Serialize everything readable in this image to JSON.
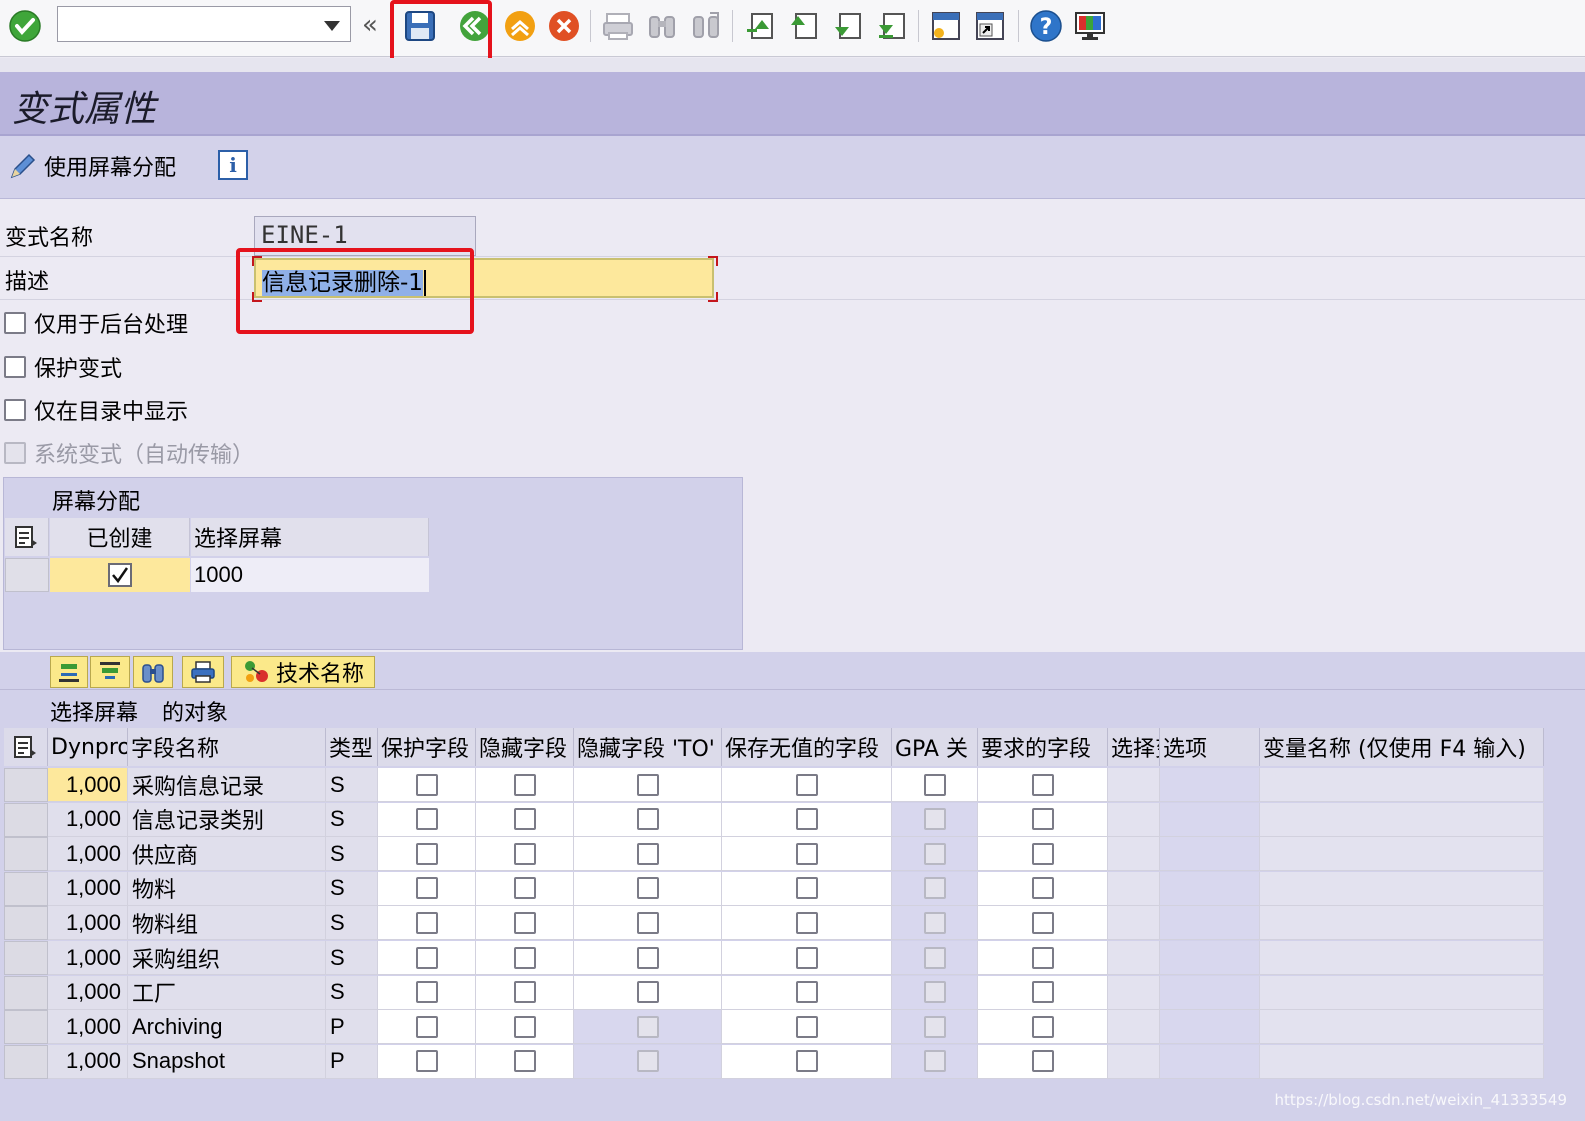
{
  "toolbar": {
    "command_field_value": "",
    "icons": [
      "enter-icon",
      "save-icon",
      "back-icon",
      "exit-icon",
      "cancel-icon",
      "print-icon",
      "find-icon",
      "find-next-icon",
      "first-page-icon",
      "previous-page-icon",
      "next-page-icon",
      "last-page-icon",
      "create-session-icon",
      "shortcut-icon",
      "help-icon",
      "layout-icon"
    ]
  },
  "page": {
    "title": "变式属性"
  },
  "app_toolbar": {
    "screen_assignment_label": "使用屏幕分配",
    "info_glyph": "i"
  },
  "form": {
    "variant_name_label": "变式名称",
    "variant_name_value": "EINE-1",
    "description_label": "描述",
    "description_value": "信息记录删除-1",
    "checkboxes": [
      {
        "label": "仅用于后台处理",
        "checked": false,
        "enabled": true
      },
      {
        "label": "保护变式",
        "checked": false,
        "enabled": true
      },
      {
        "label": "仅在目录中显示",
        "checked": false,
        "enabled": true
      },
      {
        "label": "系统变式（自动传输）",
        "checked": false,
        "enabled": false
      }
    ]
  },
  "screen_assignment": {
    "title": "屏幕分配",
    "col_created": "已创建",
    "col_screen": "选择屏幕",
    "rows": [
      {
        "created": true,
        "screen": "1000"
      }
    ]
  },
  "objects": {
    "tech_name_button": "技术名称",
    "title_part1": "选择屏幕",
    "title_part2": "的对象",
    "headers": [
      "Dynpro",
      "字段名称",
      "类型",
      "保护字段",
      "隐藏字段",
      "隐藏字段 'TO'",
      "保存无值的字段",
      "GPA 关",
      "要求的字段",
      "选择变量",
      "选项",
      "变量名称 (仅使用 F4 输入)"
    ],
    "rows": [
      {
        "dynpro": "1,000",
        "field": "采购信息记录",
        "type": "S"
      },
      {
        "dynpro": "1,000",
        "field": "信息记录类别",
        "type": "S"
      },
      {
        "dynpro": "1,000",
        "field": "供应商",
        "type": "S"
      },
      {
        "dynpro": "1,000",
        "field": "物料",
        "type": "S"
      },
      {
        "dynpro": "1,000",
        "field": "物料组",
        "type": "S"
      },
      {
        "dynpro": "1,000",
        "field": "采购组织",
        "type": "S"
      },
      {
        "dynpro": "1,000",
        "field": "工厂",
        "type": "S"
      },
      {
        "dynpro": "1,000",
        "field": "Archiving",
        "type": "P"
      },
      {
        "dynpro": "1,000",
        "field": "Snapshot",
        "type": "P"
      }
    ]
  },
  "watermark": "https://blog.csdn.net/weixin_41333549",
  "colors": {
    "title_bar": "#b8b4dc",
    "input_highlight": "#fde89c",
    "annotation_red": "#e5121c"
  }
}
